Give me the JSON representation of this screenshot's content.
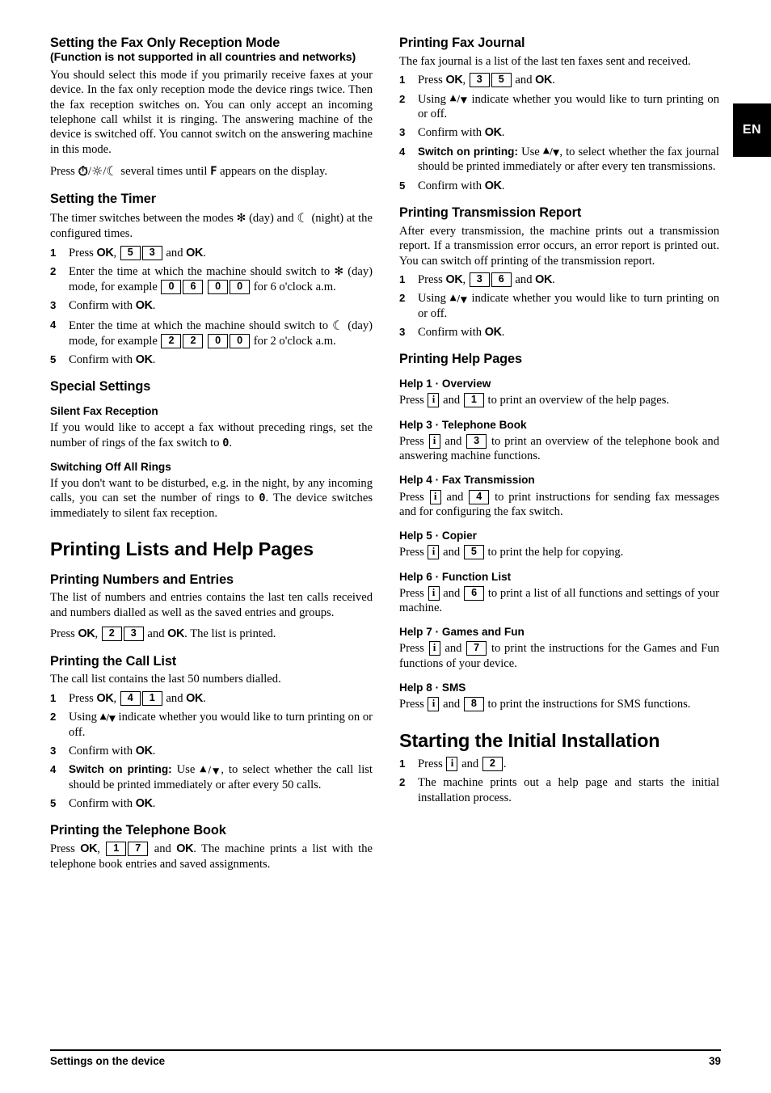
{
  "page": {
    "language_tab": "EN",
    "footer_left": "Settings on the device",
    "footer_page_number": "39"
  },
  "left_column": {
    "fax_only": {
      "heading": "Setting the Fax Only Reception Mode",
      "heading_sub": "(Function is not supported in all countries and networks)",
      "para": "You should select this mode if you primarily receive faxes at your device. In the fax only reception mode the device rings twice. Then the fax reception switches on. You can only accept an incoming telephone call whilst it is ringing. The answering machine of the device is switched off. You cannot switch on the answering machine in this mode.",
      "press_prefix": "Press",
      "key_timer": "⏱",
      "key_sun": "☼",
      "key_moon": "☾",
      "press_suffix_a": "several times until",
      "display_char": "F",
      "press_suffix_b": "appears on the display."
    },
    "timer": {
      "heading": "Setting the Timer",
      "para_a": "The timer switches between the modes",
      "sym_day": "✻",
      "para_b": "(day) and",
      "sym_night": "☾",
      "para_c": "(night) at the configured times.",
      "steps": [
        {
          "num": "1",
          "press": "Press",
          "ok": "OK",
          "keys": [
            "5",
            "3"
          ],
          "and": "and",
          "ok2": "OK",
          "tail": "."
        },
        {
          "num": "2",
          "text_a": "Enter the time at which the machine should switch to",
          "sym": "✻",
          "text_b": "(day) mode, for example",
          "keys": [
            "0",
            "6",
            "0",
            "0"
          ],
          "text_c": "for 6 o'clock a.m."
        },
        {
          "num": "3",
          "text": "Confirm with",
          "ok": "OK",
          "tail": "."
        },
        {
          "num": "4",
          "text_a": "Enter the time at which the machine should switch to",
          "sym": "☾",
          "text_b": "(day) mode, for example",
          "keys": [
            "2",
            "2",
            "0",
            "0"
          ],
          "text_c": "for 2 o'clock a.m."
        },
        {
          "num": "5",
          "text": "Confirm with",
          "ok": "OK",
          "tail": "."
        }
      ]
    },
    "special_settings": {
      "heading": "Special Settings",
      "silent": {
        "heading": "Silent Fax Reception",
        "text_a": "If you would like to accept a fax without preceding rings, set the number of rings of the fax switch to",
        "value": "0",
        "text_b": "."
      },
      "switch_off": {
        "heading": "Switching Off All Rings",
        "text_a": "If you don't want to be disturbed, e.g. in the night, by any incoming calls, you can set the number of rings to",
        "value": "0",
        "text_b": ". The device switches immediately to silent fax reception."
      }
    },
    "printing_lists": {
      "chapter": "Printing Lists and Help Pages",
      "numbers_entries": {
        "heading": "Printing Numbers and Entries",
        "para": "The list of numbers and entries contains the last ten calls received and numbers dialled as well as the saved entries and groups.",
        "press": "Press",
        "ok": "OK",
        "keys": [
          "2",
          "3"
        ],
        "and": "and",
        "ok2": "OK",
        "tail": ". The list is printed."
      },
      "call_list": {
        "heading": "Printing the Call List",
        "para": "The call list contains the last 50 numbers dialled.",
        "steps": [
          {
            "num": "1",
            "press": "Press",
            "ok": "OK",
            "keys": [
              "4",
              "1"
            ],
            "and": "and",
            "ok2": "OK",
            "tail": "."
          },
          {
            "num": "2",
            "text_a": "Using",
            "text_b": "indicate whether you would like to turn printing on or off."
          },
          {
            "num": "3",
            "text": "Confirm with",
            "ok": "OK",
            "tail": "."
          },
          {
            "num": "4",
            "lead": "Switch on printing:",
            "text_a": "Use",
            "text_b": ", to select whether the call list should be printed immediately or after every 50 calls."
          },
          {
            "num": "5",
            "text": "Confirm with",
            "ok": "OK",
            "tail": "."
          }
        ]
      },
      "telephone_book": {
        "heading": "Printing the Telephone Book",
        "press": "Press",
        "ok": "OK",
        "keys": [
          "1",
          "7"
        ],
        "and": "and",
        "ok2": "OK",
        "tail": ". The machine prints a list with the telephone book entries and saved assignments."
      }
    }
  },
  "right_column": {
    "fax_journal": {
      "heading": "Printing Fax Journal",
      "para": "The fax journal is a list of the last ten faxes sent and received.",
      "steps": [
        {
          "num": "1",
          "press": "Press",
          "ok": "OK",
          "keys": [
            "3",
            "5"
          ],
          "and": "and",
          "ok2": "OK",
          "tail": "."
        },
        {
          "num": "2",
          "text_a": "Using",
          "text_b": "indicate whether you would like to turn printing on or off."
        },
        {
          "num": "3",
          "text": "Confirm with",
          "ok": "OK",
          "tail": "."
        },
        {
          "num": "4",
          "lead": "Switch on printing:",
          "text_a": "Use",
          "text_b": ", to select whether the fax journal should be printed immediately or after every ten transmissions."
        },
        {
          "num": "5",
          "text": "Confirm with",
          "ok": "OK",
          "tail": "."
        }
      ]
    },
    "transmission_report": {
      "heading": "Printing Transmission Report",
      "para": "After every transmission, the machine prints out a transmission report. If a transmission error occurs, an error report is printed out. You can switch off printing of the transmission report.",
      "steps": [
        {
          "num": "1",
          "press": "Press",
          "ok": "OK",
          "keys": [
            "3",
            "6"
          ],
          "and": "and",
          "ok2": "OK",
          "tail": "."
        },
        {
          "num": "2",
          "text_a": "Using",
          "text_b": "indicate whether you would like to turn printing on or off."
        },
        {
          "num": "3",
          "text": "Confirm with",
          "ok": "OK",
          "tail": "."
        }
      ]
    },
    "help_pages": {
      "heading": "Printing Help Pages",
      "items": [
        {
          "heading": "Help 1 · Overview",
          "press": "Press",
          "info_key": "i",
          "and": "and",
          "key": "1",
          "text": "to print an overview of the help pages."
        },
        {
          "heading": "Help 3 · Telephone Book",
          "press": "Press",
          "info_key": "i",
          "and": "and",
          "key": "3",
          "text": "to print an overview of the telephone book and answering machine functions."
        },
        {
          "heading": "Help 4 · Fax Transmission",
          "press": "Press",
          "info_key": "i",
          "and": "and",
          "key": "4",
          "text": "to print instructions for sending fax messages and for configuring the fax switch."
        },
        {
          "heading": "Help 5 · Copier",
          "press": "Press",
          "info_key": "i",
          "and": "and",
          "key": "5",
          "text": "to print the help for copying."
        },
        {
          "heading": "Help 6 · Function List",
          "press": "Press",
          "info_key": "i",
          "and": "and",
          "key": "6",
          "text": "to print a list of all functions and settings of your machine."
        },
        {
          "heading": "Help 7 · Games and Fun",
          "press": "Press",
          "info_key": "i",
          "and": "and",
          "key": "7",
          "text": "to print the instructions for the Games and Fun functions of your device."
        },
        {
          "heading": "Help 8 · SMS",
          "press": "Press",
          "info_key": "i",
          "and": "and",
          "key": "8",
          "text": "to print the instructions for SMS functions."
        }
      ]
    },
    "initial_installation": {
      "chapter": "Starting the Initial Installation",
      "steps": [
        {
          "num": "1",
          "press": "Press",
          "info_key": "i",
          "and": "and",
          "key": "2",
          "tail": "."
        },
        {
          "num": "2",
          "text": "The machine prints out a help page and starts the initial installation process."
        }
      ]
    }
  }
}
